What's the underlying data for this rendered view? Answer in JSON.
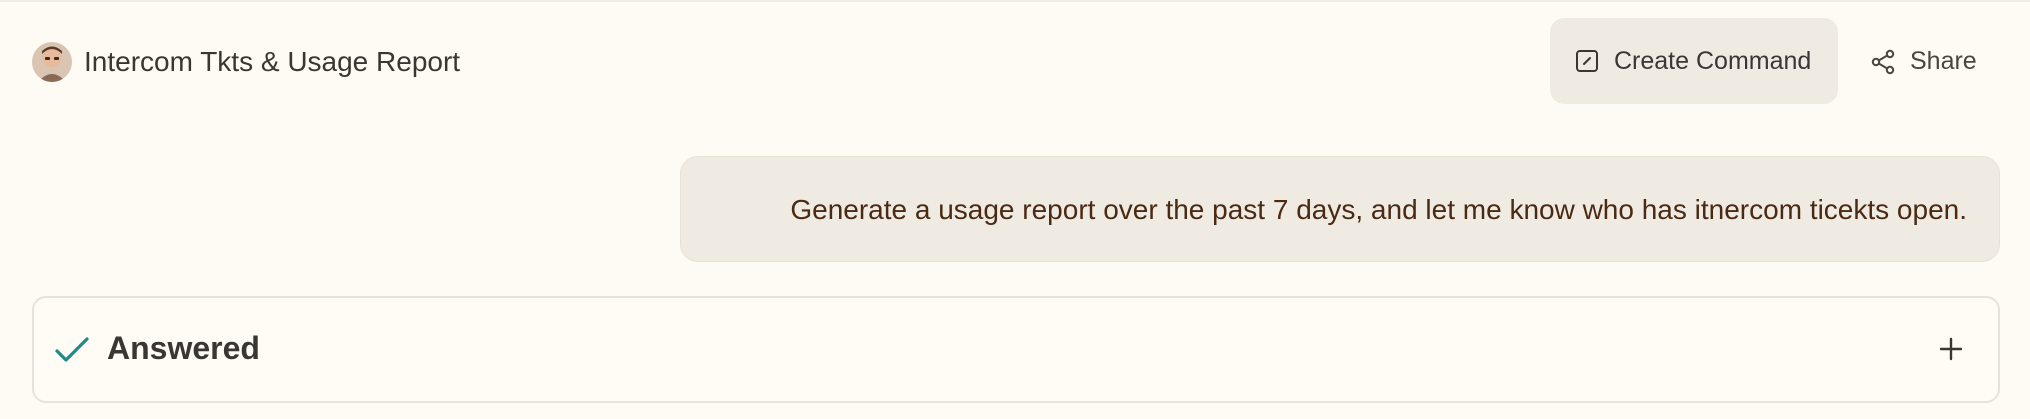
{
  "header": {
    "title": "Intercom Tkts & Usage Report",
    "avatar_icon": "user-avatar",
    "create_command_label": "Create Command",
    "create_command_icon": "edit-square-icon",
    "share_label": "Share",
    "share_icon": "share-icon"
  },
  "conversation": {
    "user_message": "Generate a usage report over the past 7 days, and let me know who has itnercom ticekts open."
  },
  "result_panel": {
    "status_label": "Answered",
    "status_icon": "check-icon",
    "expand_icon": "plus-icon"
  },
  "colors": {
    "background": "#fefbf4",
    "button_bg": "#efebe3",
    "message_text": "#4a2a12",
    "check_accent": "#1f8a86",
    "text_primary": "#3b3633"
  }
}
